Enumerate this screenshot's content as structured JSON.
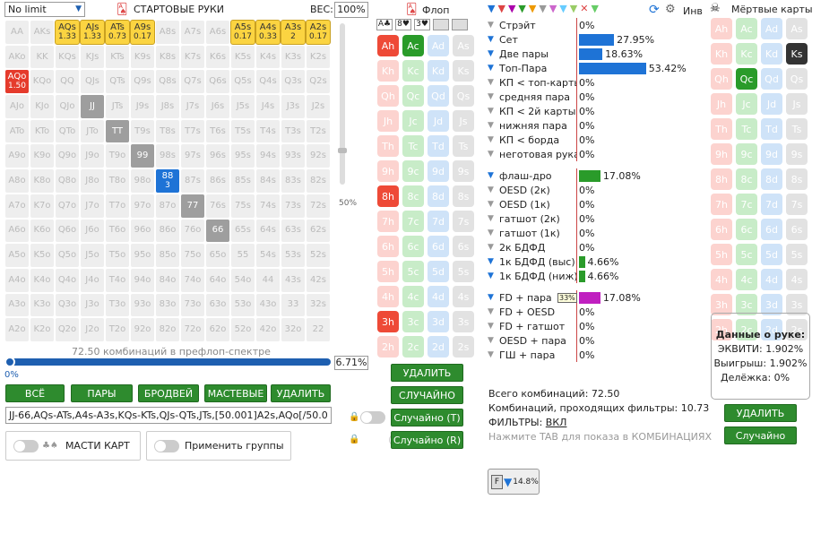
{
  "top": {
    "limit_select": "No limit",
    "section_title": "СТАРТОВЫЕ РУКИ",
    "weight_label": "ВЕС:",
    "weight_value": "100%",
    "flop_title": "Флоп",
    "inv_label": "Инв",
    "dead_title": "Мёртвые карты"
  },
  "hand_grid": {
    "rows": [
      [
        [
          "AA",
          ""
        ],
        [
          "AKs",
          ""
        ],
        [
          "AQs",
          "1.33",
          "sel"
        ],
        [
          "AJs",
          "1.33",
          "sel"
        ],
        [
          "ATs",
          "0.73",
          "sel"
        ],
        [
          "A9s",
          "0.17",
          "sel"
        ],
        [
          "A8s",
          ""
        ],
        [
          "A7s",
          ""
        ],
        [
          "A6s",
          ""
        ],
        [
          "A5s",
          "0.17",
          "sel"
        ],
        [
          "A4s",
          "0.33",
          "sel"
        ],
        [
          "A3s",
          "2",
          "sel"
        ],
        [
          "A2s",
          "0.17",
          "sel"
        ]
      ],
      [
        [
          "AKo",
          ""
        ],
        [
          "KK",
          ""
        ],
        [
          "KQs",
          ""
        ],
        [
          "KJs",
          ""
        ],
        [
          "KTs",
          ""
        ],
        [
          "K9s",
          ""
        ],
        [
          "K8s",
          ""
        ],
        [
          "K7s",
          ""
        ],
        [
          "K6s",
          ""
        ],
        [
          "K5s",
          ""
        ],
        [
          "K4s",
          ""
        ],
        [
          "K3s",
          ""
        ],
        [
          "K2s",
          ""
        ]
      ],
      [
        [
          "AQo",
          "1.50",
          "red"
        ],
        [
          "KQo",
          ""
        ],
        [
          "QQ",
          ""
        ],
        [
          "QJs",
          ""
        ],
        [
          "QTs",
          ""
        ],
        [
          "Q9s",
          ""
        ],
        [
          "Q8s",
          ""
        ],
        [
          "Q7s",
          ""
        ],
        [
          "Q6s",
          ""
        ],
        [
          "Q5s",
          ""
        ],
        [
          "Q4s",
          ""
        ],
        [
          "Q3s",
          ""
        ],
        [
          "Q2s",
          ""
        ]
      ],
      [
        [
          "AJo",
          ""
        ],
        [
          "KJo",
          ""
        ],
        [
          "QJo",
          ""
        ],
        [
          "JJ",
          "",
          "pair"
        ],
        [
          "JTs",
          ""
        ],
        [
          "J9s",
          ""
        ],
        [
          "J8s",
          ""
        ],
        [
          "J7s",
          ""
        ],
        [
          "J6s",
          ""
        ],
        [
          "J5s",
          ""
        ],
        [
          "J4s",
          ""
        ],
        [
          "J3s",
          ""
        ],
        [
          "J2s",
          ""
        ]
      ],
      [
        [
          "ATo",
          ""
        ],
        [
          "KTo",
          ""
        ],
        [
          "QTo",
          ""
        ],
        [
          "JTo",
          ""
        ],
        [
          "TT",
          "",
          "pair"
        ],
        [
          "T9s",
          ""
        ],
        [
          "T8s",
          ""
        ],
        [
          "T7s",
          ""
        ],
        [
          "T6s",
          ""
        ],
        [
          "T5s",
          ""
        ],
        [
          "T4s",
          ""
        ],
        [
          "T3s",
          ""
        ],
        [
          "T2s",
          ""
        ]
      ],
      [
        [
          "A9o",
          ""
        ],
        [
          "K9o",
          ""
        ],
        [
          "Q9o",
          ""
        ],
        [
          "J9o",
          ""
        ],
        [
          "T9o",
          ""
        ],
        [
          "99",
          "",
          "pair"
        ],
        [
          "98s",
          ""
        ],
        [
          "97s",
          ""
        ],
        [
          "96s",
          ""
        ],
        [
          "95s",
          ""
        ],
        [
          "94s",
          ""
        ],
        [
          "93s",
          ""
        ],
        [
          "92s",
          ""
        ]
      ],
      [
        [
          "A8o",
          ""
        ],
        [
          "K8o",
          ""
        ],
        [
          "Q8o",
          ""
        ],
        [
          "J8o",
          ""
        ],
        [
          "T8o",
          ""
        ],
        [
          "98o",
          ""
        ],
        [
          "88",
          "3",
          "blue"
        ],
        [
          "87s",
          ""
        ],
        [
          "86s",
          ""
        ],
        [
          "85s",
          ""
        ],
        [
          "84s",
          ""
        ],
        [
          "83s",
          ""
        ],
        [
          "82s",
          ""
        ]
      ],
      [
        [
          "A7o",
          ""
        ],
        [
          "K7o",
          ""
        ],
        [
          "Q7o",
          ""
        ],
        [
          "J7o",
          ""
        ],
        [
          "T7o",
          ""
        ],
        [
          "97o",
          ""
        ],
        [
          "87o",
          ""
        ],
        [
          "77",
          "",
          "pair"
        ],
        [
          "76s",
          ""
        ],
        [
          "75s",
          ""
        ],
        [
          "74s",
          ""
        ],
        [
          "73s",
          ""
        ],
        [
          "72s",
          ""
        ]
      ],
      [
        [
          "A6o",
          ""
        ],
        [
          "K6o",
          ""
        ],
        [
          "Q6o",
          ""
        ],
        [
          "J6o",
          ""
        ],
        [
          "T6o",
          ""
        ],
        [
          "96o",
          ""
        ],
        [
          "86o",
          ""
        ],
        [
          "76o",
          ""
        ],
        [
          "66",
          "",
          "pair"
        ],
        [
          "65s",
          ""
        ],
        [
          "64s",
          ""
        ],
        [
          "63s",
          ""
        ],
        [
          "62s",
          ""
        ]
      ],
      [
        [
          "A5o",
          ""
        ],
        [
          "K5o",
          ""
        ],
        [
          "Q5o",
          ""
        ],
        [
          "J5o",
          ""
        ],
        [
          "T5o",
          ""
        ],
        [
          "95o",
          ""
        ],
        [
          "85o",
          ""
        ],
        [
          "75o",
          ""
        ],
        [
          "65o",
          ""
        ],
        [
          "55",
          ""
        ],
        [
          "54s",
          ""
        ],
        [
          "53s",
          ""
        ],
        [
          "52s",
          ""
        ]
      ],
      [
        [
          "A4o",
          ""
        ],
        [
          "K4o",
          ""
        ],
        [
          "Q4o",
          ""
        ],
        [
          "J4o",
          ""
        ],
        [
          "T4o",
          ""
        ],
        [
          "94o",
          ""
        ],
        [
          "84o",
          ""
        ],
        [
          "74o",
          ""
        ],
        [
          "64o",
          ""
        ],
        [
          "54o",
          ""
        ],
        [
          "44",
          ""
        ],
        [
          "43s",
          ""
        ],
        [
          "42s",
          ""
        ]
      ],
      [
        [
          "A3o",
          ""
        ],
        [
          "K3o",
          ""
        ],
        [
          "Q3o",
          ""
        ],
        [
          "J3o",
          ""
        ],
        [
          "T3o",
          ""
        ],
        [
          "93o",
          ""
        ],
        [
          "83o",
          ""
        ],
        [
          "73o",
          ""
        ],
        [
          "63o",
          ""
        ],
        [
          "53o",
          ""
        ],
        [
          "43o",
          ""
        ],
        [
          "33",
          ""
        ],
        [
          "32s",
          ""
        ]
      ],
      [
        [
          "A2o",
          ""
        ],
        [
          "K2o",
          ""
        ],
        [
          "Q2o",
          ""
        ],
        [
          "J2o",
          ""
        ],
        [
          "T2o",
          ""
        ],
        [
          "92o",
          ""
        ],
        [
          "82o",
          ""
        ],
        [
          "72o",
          ""
        ],
        [
          "62o",
          ""
        ],
        [
          "52o",
          ""
        ],
        [
          "42o",
          ""
        ],
        [
          "32o",
          ""
        ],
        [
          "22",
          ""
        ]
      ]
    ],
    "combos_text": "72.50 комбинаций в префлоп-спектре",
    "slider_left": "0%",
    "slider_value": "6.71%",
    "weight_slider_label": "50%",
    "weight_fraction": 0.5
  },
  "buttons": {
    "all": "ВСЁ",
    "pairs": "ПАРЫ",
    "broadway": "БРОДВЕЙ",
    "suited": "МАСТЕВЫЕ",
    "delete": "УДАЛИТЬ"
  },
  "range_text": "JJ-66,AQs-ATs,A4s-A3s,KQs-KTs,QJs-QTs,JTs,[50.001]A2s,AQo[/50.0",
  "toggles": {
    "suits": "МАСТИ КАРТ",
    "groups": "Применить группы"
  },
  "flop": {
    "tabs": [
      "A♣",
      "8♥",
      "3♥",
      "",
      ""
    ],
    "rows": [
      [
        [
          "Ah",
          "h",
          "act"
        ],
        [
          "Ac",
          "c",
          "act"
        ],
        [
          "Ad",
          "d",
          ""
        ],
        [
          "As",
          "s",
          ""
        ]
      ],
      [
        [
          "Kh",
          "h",
          ""
        ],
        [
          "Kc",
          "c",
          ""
        ],
        [
          "Kd",
          "d",
          ""
        ],
        [
          "Ks",
          "s",
          ""
        ]
      ],
      [
        [
          "Qh",
          "h",
          ""
        ],
        [
          "Qc",
          "c",
          ""
        ],
        [
          "Qd",
          "d",
          ""
        ],
        [
          "Qs",
          "s",
          ""
        ]
      ],
      [
        [
          "Jh",
          "h",
          ""
        ],
        [
          "Jc",
          "c",
          ""
        ],
        [
          "Jd",
          "d",
          ""
        ],
        [
          "Js",
          "s",
          ""
        ]
      ],
      [
        [
          "Th",
          "h",
          ""
        ],
        [
          "Tc",
          "c",
          ""
        ],
        [
          "Td",
          "d",
          ""
        ],
        [
          "Ts",
          "s",
          ""
        ]
      ],
      [
        [
          "9h",
          "h",
          ""
        ],
        [
          "9c",
          "c",
          ""
        ],
        [
          "9d",
          "d",
          ""
        ],
        [
          "9s",
          "s",
          ""
        ]
      ],
      [
        [
          "8h",
          "h",
          "act"
        ],
        [
          "8c",
          "c",
          ""
        ],
        [
          "8d",
          "d",
          ""
        ],
        [
          "8s",
          "s",
          ""
        ]
      ],
      [
        [
          "7h",
          "h",
          ""
        ],
        [
          "7c",
          "c",
          ""
        ],
        [
          "7d",
          "d",
          ""
        ],
        [
          "7s",
          "s",
          ""
        ]
      ],
      [
        [
          "6h",
          "h",
          ""
        ],
        [
          "6c",
          "c",
          ""
        ],
        [
          "6d",
          "d",
          ""
        ],
        [
          "6s",
          "s",
          ""
        ]
      ],
      [
        [
          "5h",
          "h",
          ""
        ],
        [
          "5c",
          "c",
          ""
        ],
        [
          "5d",
          "d",
          ""
        ],
        [
          "5s",
          "s",
          ""
        ]
      ],
      [
        [
          "4h",
          "h",
          ""
        ],
        [
          "4c",
          "c",
          ""
        ],
        [
          "4d",
          "d",
          ""
        ],
        [
          "4s",
          "s",
          ""
        ]
      ],
      [
        [
          "3h",
          "h",
          "act"
        ],
        [
          "3c",
          "c",
          ""
        ],
        [
          "3d",
          "d",
          ""
        ],
        [
          "3s",
          "s",
          ""
        ]
      ],
      [
        [
          "2h",
          "h",
          ""
        ],
        [
          "2c",
          "c",
          ""
        ],
        [
          "2d",
          "d",
          ""
        ],
        [
          "2s",
          "s",
          ""
        ]
      ]
    ],
    "delete": "УДАЛИТЬ",
    "random": "СЛУЧАЙНО",
    "random_t": "Случайно (T)",
    "random_r": "Случайно (R)"
  },
  "stats": {
    "groups": [
      [
        [
          "Стрэйт",
          "0%",
          0,
          ""
        ],
        [
          "Сет",
          "27.95%",
          27.95,
          "#1e73d6"
        ],
        [
          "Две пары",
          "18.63%",
          18.63,
          "#1e73d6"
        ],
        [
          "Топ-Пара",
          "53.42%",
          53.42,
          "#1e73d6"
        ],
        [
          "КП < топ-карты",
          "0%",
          0,
          ""
        ],
        [
          "средняя пара",
          "0%",
          0,
          ""
        ],
        [
          "КП < 2й карты",
          "0%",
          0,
          ""
        ],
        [
          "нижняя пара",
          "0%",
          0,
          ""
        ],
        [
          "КП < борда",
          "0%",
          0,
          ""
        ],
        [
          "неготовая рука",
          "0%",
          0,
          ""
        ]
      ],
      [
        [
          "флаш-дро",
          "17.08%",
          17.08,
          "#2a9b2a"
        ],
        [
          "OESD (2к)",
          "0%",
          0,
          ""
        ],
        [
          "OESD (1к)",
          "0%",
          0,
          ""
        ],
        [
          "гатшот (2к)",
          "0%",
          0,
          ""
        ],
        [
          "гатшот (1к)",
          "0%",
          0,
          ""
        ],
        [
          "2к БДФД",
          "0%",
          0,
          ""
        ],
        [
          "1к БДФД (выс)",
          "4.66%",
          4.66,
          "#2a9b2a"
        ],
        [
          "1к БДФД (ниж)",
          "4.66%",
          4.66,
          "#2a9b2a"
        ]
      ],
      [
        [
          "FD + пара",
          "17.08%",
          17.08,
          "#c020c0"
        ],
        [
          "FD + OESD",
          "0%",
          0,
          ""
        ],
        [
          "FD + гатшот",
          "0%",
          0,
          ""
        ],
        [
          "OESD + пара",
          "0%",
          0,
          ""
        ],
        [
          "ГШ + пара",
          "0%",
          0,
          ""
        ]
      ]
    ],
    "fd_badge": "33%",
    "total": "Всего комбинаций: 72.50",
    "passing": "Комбинаций, проходящих фильтры: 10.73",
    "filters_label": "ФИЛЬТРЫ:",
    "filters_value": "ВКЛ",
    "tab_hint": "Нажмите TAB для показа в КОМБИНАЦИЯХ",
    "filter_badge": "14.8%"
  },
  "dead": {
    "rows": [
      [
        [
          "Ah",
          "h",
          ""
        ],
        [
          "Ac",
          "c",
          ""
        ],
        [
          "Ad",
          "d",
          ""
        ],
        [
          "As",
          "s",
          ""
        ]
      ],
      [
        [
          "Kh",
          "h",
          ""
        ],
        [
          "Kc",
          "c",
          ""
        ],
        [
          "Kd",
          "d",
          ""
        ],
        [
          "Ks",
          "s",
          "act"
        ]
      ],
      [
        [
          "Qh",
          "h",
          ""
        ],
        [
          "Qc",
          "c",
          "act"
        ],
        [
          "Qd",
          "d",
          ""
        ],
        [
          "Qs",
          "s",
          ""
        ]
      ],
      [
        [
          "Jh",
          "h",
          ""
        ],
        [
          "Jc",
          "c",
          ""
        ],
        [
          "Jd",
          "d",
          ""
        ],
        [
          "Js",
          "s",
          ""
        ]
      ],
      [
        [
          "Th",
          "h",
          ""
        ],
        [
          "Tc",
          "c",
          ""
        ],
        [
          "Td",
          "d",
          ""
        ],
        [
          "Ts",
          "s",
          ""
        ]
      ],
      [
        [
          "9h",
          "h",
          ""
        ],
        [
          "9c",
          "c",
          ""
        ],
        [
          "9d",
          "d",
          ""
        ],
        [
          "9s",
          "s",
          ""
        ]
      ],
      [
        [
          "8h",
          "h",
          ""
        ],
        [
          "8c",
          "c",
          ""
        ],
        [
          "8d",
          "d",
          ""
        ],
        [
          "8s",
          "s",
          ""
        ]
      ],
      [
        [
          "7h",
          "h",
          ""
        ],
        [
          "7c",
          "c",
          ""
        ],
        [
          "7d",
          "d",
          ""
        ],
        [
          "7s",
          "s",
          ""
        ]
      ],
      [
        [
          "6h",
          "h",
          ""
        ],
        [
          "6c",
          "c",
          ""
        ],
        [
          "6d",
          "d",
          ""
        ],
        [
          "6s",
          "s",
          ""
        ]
      ],
      [
        [
          "5h",
          "h",
          ""
        ],
        [
          "5c",
          "c",
          ""
        ],
        [
          "5d",
          "d",
          ""
        ],
        [
          "5s",
          "s",
          ""
        ]
      ],
      [
        [
          "4h",
          "h",
          ""
        ],
        [
          "4c",
          "c",
          ""
        ],
        [
          "4d",
          "d",
          ""
        ],
        [
          "4s",
          "s",
          ""
        ]
      ],
      [
        [
          "3h",
          "h",
          ""
        ],
        [
          "3c",
          "c",
          ""
        ],
        [
          "3d",
          "d",
          ""
        ],
        [
          "3s",
          "s",
          ""
        ]
      ],
      [
        [
          "2h",
          "h",
          ""
        ],
        [
          "2c",
          "c",
          ""
        ],
        [
          "2d",
          "d",
          ""
        ],
        [
          "2s",
          "s",
          ""
        ]
      ]
    ],
    "info_title": "Данные о руке:",
    "equity": "ЭКВИТИ: 1.902%",
    "win": "Выигрыш: 1.902%",
    "split": "Делёжка: 0%",
    "delete": "УДАЛИТЬ",
    "random": "Случайно"
  }
}
